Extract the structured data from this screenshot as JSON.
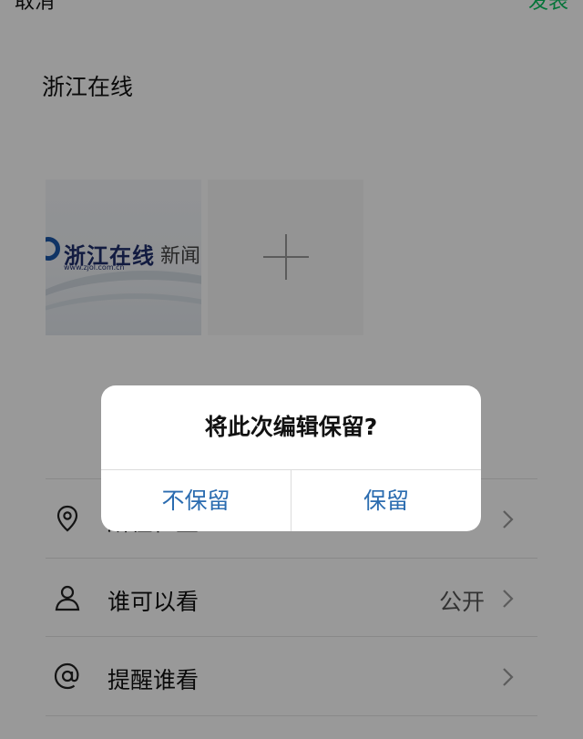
{
  "header": {
    "cancel_label": "取消",
    "publish_label": "发表"
  },
  "post": {
    "text": "浙江在线"
  },
  "attachment": {
    "logo_text": "浙江在线",
    "logo_url": "www.zjol.com.cn",
    "news_text": "新闻"
  },
  "options": [
    {
      "label": "所在位置",
      "value": "",
      "icon": "location-pin-icon"
    },
    {
      "label": "谁可以看",
      "value": "公开",
      "icon": "person-icon"
    },
    {
      "label": "提醒谁看",
      "value": "",
      "icon": "at-sign-icon"
    }
  ],
  "dialog": {
    "title": "将此次编辑保留?",
    "discard_label": "不保留",
    "keep_label": "保留"
  },
  "colors": {
    "publish": "#07c160",
    "dialog_button": "#2b6cb0",
    "overlay": "rgba(0,0,0,0.4)"
  }
}
